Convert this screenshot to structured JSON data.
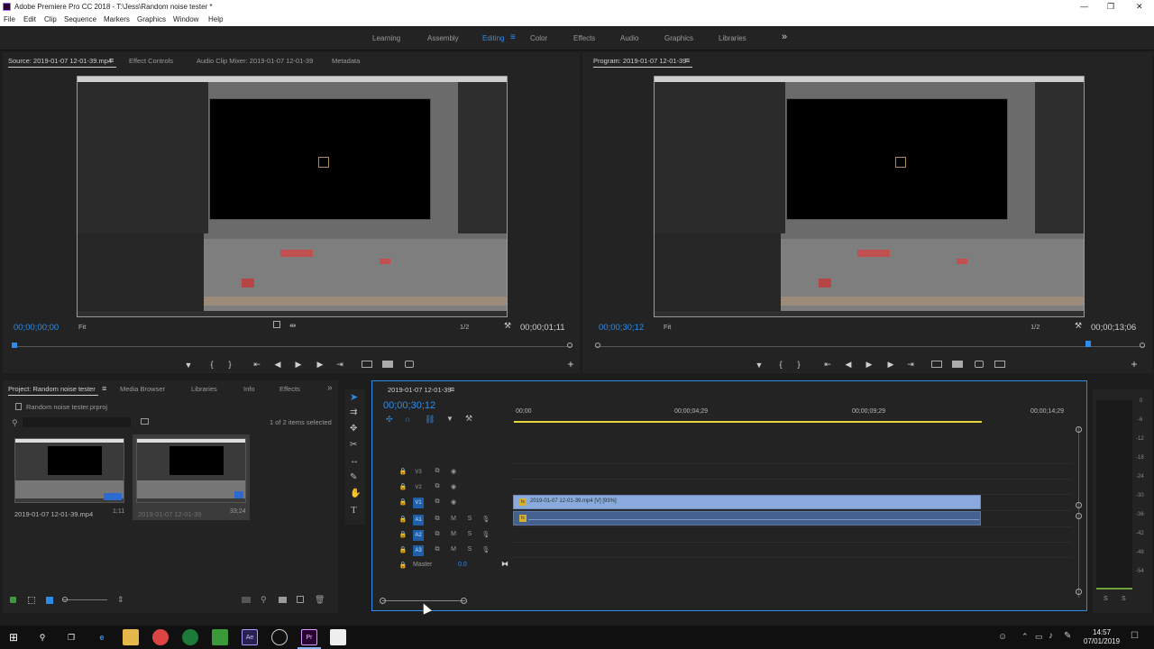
{
  "window": {
    "title": "Adobe Premiere Pro CC 2018 - T:\\Jess\\Random noise tester *",
    "controls": {
      "minimize": "—",
      "maximize": "❐",
      "close": "✕"
    }
  },
  "menu": [
    "File",
    "Edit",
    "Clip",
    "Sequence",
    "Markers",
    "Graphics",
    "Window",
    "Help"
  ],
  "workspaces": {
    "items": [
      "Learning",
      "Assembly",
      "Editing",
      "Color",
      "Effects",
      "Audio",
      "Graphics",
      "Libraries"
    ],
    "active": "Editing",
    "menu_glyph": "≡",
    "overflow": "»"
  },
  "source_panel": {
    "tabs": [
      "Source: 2019-01-07 12-01-39.mp4",
      "Effect Controls",
      "Audio Clip Mixer: 2019-01-07 12-01-39",
      "Metadata"
    ],
    "tab_menu_glyph": "≡",
    "timecode_left": "00;00;00;00",
    "fit": "Fit",
    "resolution": "1/2",
    "timecode_right": "00;00;01;11"
  },
  "program_panel": {
    "tab": "Program: 2019-01-07 12-01-39",
    "tab_menu_glyph": "≡",
    "timecode_left": "00;00;30;12",
    "fit": "Fit",
    "resolution": "1/2",
    "timecode_right": "00;00;13;06"
  },
  "transport": {
    "marker": "▼",
    "in": "{",
    "out": "}",
    "go_in": "⇤",
    "step_back": "◀",
    "play": "▶",
    "step_fwd": "▶",
    "go_out": "⇥",
    "add": "+"
  },
  "project_panel": {
    "tabs": [
      "Project: Random noise tester",
      "Media Browser",
      "Libraries",
      "Info",
      "Effects"
    ],
    "overflow": "»",
    "project_file": "Random noise tester.prproj",
    "items_selected": "1 of 2 items selected",
    "items": [
      {
        "name": "2019-01-07 12-01-39.mp4",
        "duration": "1;11"
      },
      {
        "name": "2019-01-07 12-01-39",
        "duration": "33;24"
      }
    ]
  },
  "timeline": {
    "tab": "2019-01-07 12-01-39",
    "tab_menu_glyph": "≡",
    "timecode": "00;00;30;12",
    "ruler": [
      "00;00",
      "00;00;04;29",
      "00;00;09;29",
      "00;00;14;29"
    ],
    "video_tracks": [
      "V3",
      "V2",
      "V1"
    ],
    "audio_tracks": [
      "A1",
      "A2",
      "A3"
    ],
    "master_label": "Master",
    "master_value": "0.0",
    "video_clip_label": "2019-01-07 12-01-39.mp4 [V] [93%]",
    "fx_badge": "fx",
    "track_m": "M",
    "track_s": "S"
  },
  "audio_meter": {
    "scale": [
      "0",
      "-6",
      "-12",
      "-18",
      "-24",
      "-30",
      "-36",
      "-42",
      "-48",
      "-54"
    ],
    "solo_left": "S",
    "solo_right": "S"
  },
  "taskbar": {
    "time": "14:57",
    "date": "07/01/2019",
    "apps": [
      "Start",
      "Search",
      "Task View",
      "Edge",
      "Explorer",
      "Chrome",
      "Zoom",
      "Spotify",
      "After Effects",
      "OBS",
      "Premiere Pro",
      "Clapper"
    ]
  },
  "colors": {
    "accent": "#2d8ceb",
    "video_clip": "#8aa9dc",
    "audio_clip": "#44608f",
    "track_on": "#1f5fa8",
    "fx_badge": "#d6b02b"
  }
}
